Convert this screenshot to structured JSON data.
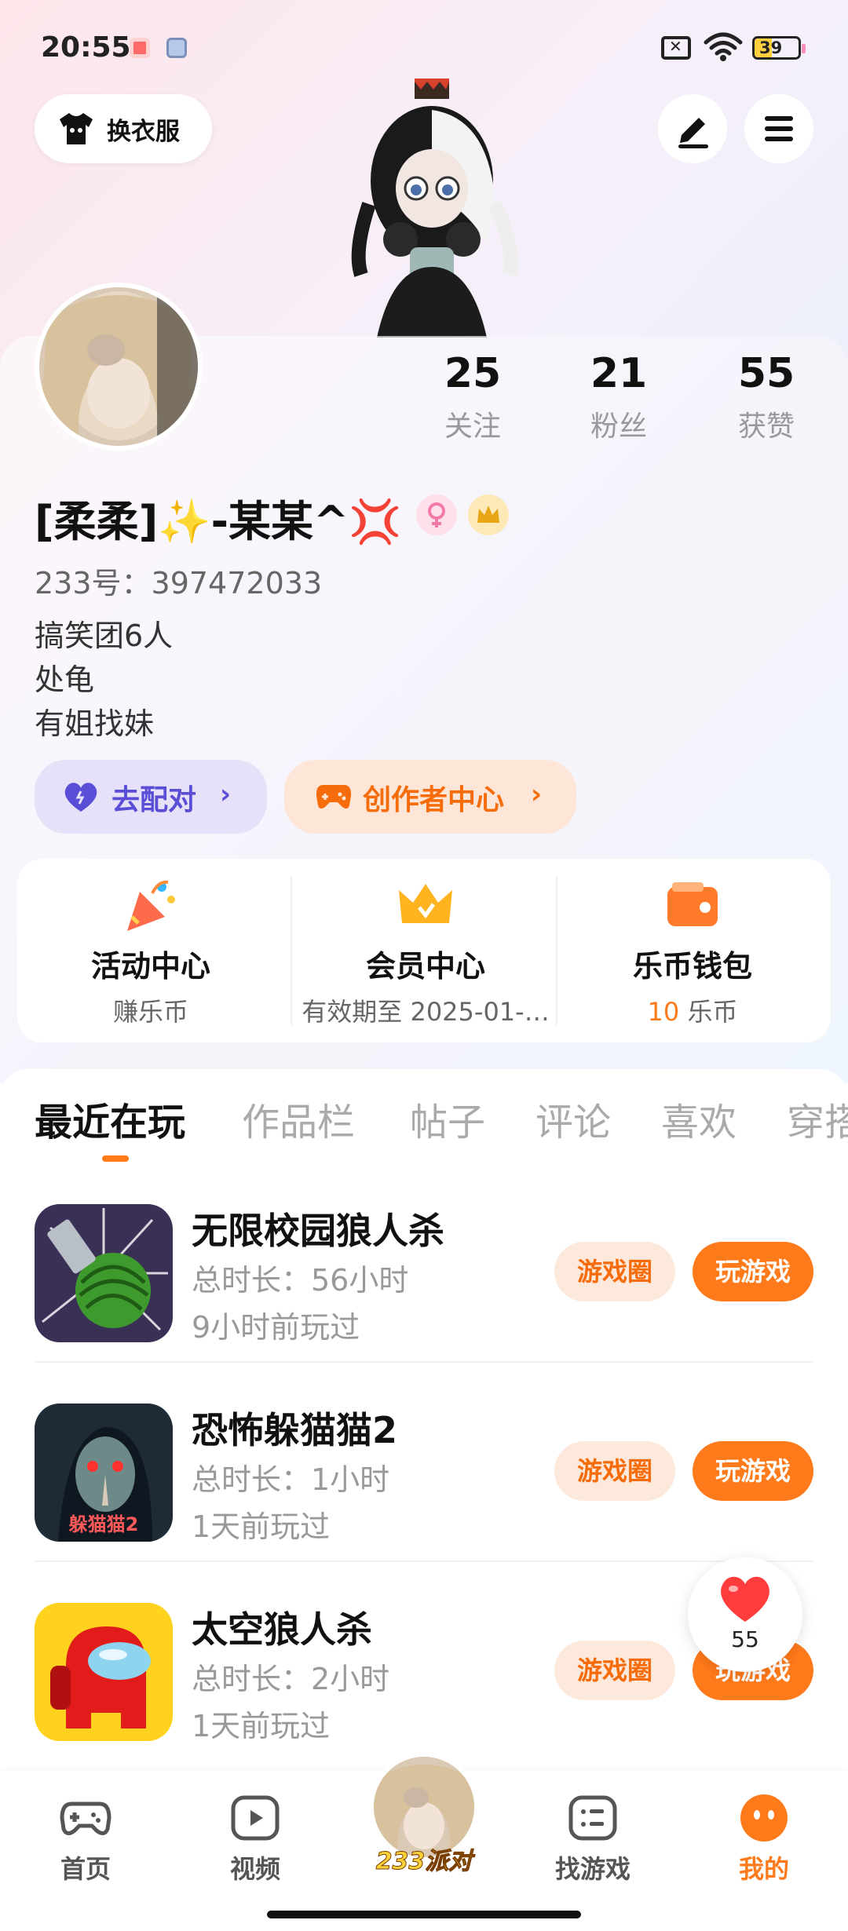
{
  "status_bar": {
    "time": "20:55",
    "battery": "39",
    "battery_level": 0.39
  },
  "header": {
    "dress_label": "换衣服"
  },
  "profile": {
    "stats": [
      {
        "value": "25",
        "label": "关注"
      },
      {
        "value": "21",
        "label": "粉丝"
      },
      {
        "value": "55",
        "label": "获赞"
      }
    ],
    "nickname": "[柔柔]✨-某某^💢",
    "uid": "233号：397472033",
    "bio": [
      "搞笑团6人",
      "处龟",
      "有姐找妹"
    ]
  },
  "actions": {
    "pair_label": "去配对",
    "creator_label": "创作者中心"
  },
  "quick": [
    {
      "title": "活动中心",
      "sub": "赚乐币",
      "icon": "party-popper-icon"
    },
    {
      "title": "会员中心",
      "sub": "有效期至 2025-01-…",
      "icon": "crown-icon"
    },
    {
      "title": "乐币钱包",
      "sub_num": "10",
      "sub_unit": " 乐币",
      "icon": "wallet-icon"
    }
  ],
  "tabs": [
    "最近在玩",
    "作品栏",
    "帖子",
    "评论",
    "喜欢",
    "穿搭"
  ],
  "games": [
    {
      "name": "无限校园狼人杀",
      "time": "总时长：56小时",
      "last": "9小时前玩过"
    },
    {
      "name": "恐怖躲猫猫2",
      "time": "总时长：1小时",
      "last": "1天前玩过",
      "icon_text": "躲猫猫2"
    },
    {
      "name": "太空狼人杀",
      "time": "总时长：2小时",
      "last": "1天前玩过"
    }
  ],
  "game_buttons": {
    "circle": "游戏圈",
    "play": "玩游戏"
  },
  "likes_float": {
    "count": "55"
  },
  "nav": {
    "home": "首页",
    "video": "视频",
    "center": "233派对",
    "find": "找游戏",
    "mine": "我的"
  },
  "colors": {
    "accent": "#ff7a1a",
    "pair": "#5a4ed6"
  }
}
